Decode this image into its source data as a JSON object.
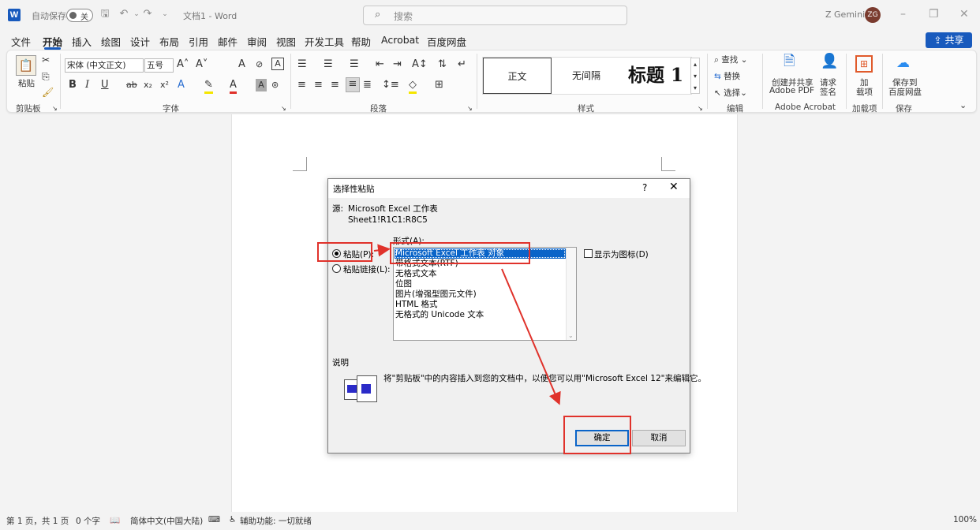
{
  "window": {
    "app_logo": "W",
    "autosave_label": "自动保存",
    "autosave_state": "关",
    "doc_title": "文档1 - Word",
    "search_placeholder": "搜索",
    "user_name": "Z Gemini",
    "user_initials": "ZG"
  },
  "tabs": [
    "文件",
    "开始",
    "插入",
    "绘图",
    "设计",
    "布局",
    "引用",
    "邮件",
    "审阅",
    "视图",
    "开发工具",
    "帮助",
    "Acrobat",
    "百度网盘"
  ],
  "share_label": "共享",
  "ribbon": {
    "clipboard": {
      "paste": "粘贴",
      "group": "剪贴板"
    },
    "font": {
      "font_name": "宋体 (中文正文)",
      "font_size": "五号",
      "group": "字体"
    },
    "paragraph": {
      "group": "段落"
    },
    "styles": {
      "items": [
        "正文",
        "无间隔",
        "标题 1"
      ],
      "group": "样式"
    },
    "editing": {
      "find": "查找",
      "replace": "替换",
      "select": "选择",
      "group": "编辑"
    },
    "acrobat": {
      "create_line1": "创建并共享",
      "create_line2": "Adobe PDF",
      "request_line1": "请求",
      "request_line2": "签名",
      "group": "Adobe Acrobat"
    },
    "addins": {
      "line1": "加",
      "line2": "载项",
      "group": "加载项"
    },
    "save": {
      "line1": "保存到",
      "line2": "百度网盘",
      "group": "保存"
    }
  },
  "dialog": {
    "title": "选择性粘贴",
    "help": "?",
    "source_label": "源:",
    "source_value": "Microsoft Excel 工作表",
    "source_range": "Sheet1!R1C1:R8C5",
    "as_label": "形式(A):",
    "paste_option": "粘贴(P):",
    "paste_link_option": "粘贴链接(L):",
    "formats": [
      "Microsoft Excel 工作表 对象",
      "带格式文本(RTF)",
      "无格式文本",
      "位图",
      "图片(增强型图元文件)",
      "HTML 格式",
      "无格式的 Unicode 文本"
    ],
    "selected_format_index": 0,
    "display_as_icon": "显示为图标(D)",
    "result_label": "说明",
    "result_text": "将\"剪贴板\"中的内容插入到您的文档中，以便您可以用\"Microsoft Excel 12\"来编辑它。",
    "ok": "确定",
    "cancel": "取消"
  },
  "statusbar": {
    "page": "第 1 页，共 1 页",
    "words": "0 个字",
    "language": "简体中文(中国大陆)",
    "accessibility": "辅助功能: 一切就绪",
    "zoom": "100%"
  },
  "colors": {
    "accent": "#185abd",
    "highlight": "#e0322b",
    "selection": "#0a64c8"
  }
}
